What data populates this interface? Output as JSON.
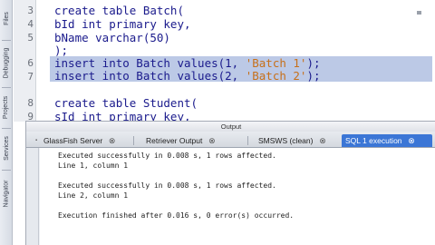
{
  "sidebar": {
    "tabs": [
      {
        "id": "files",
        "label": "Files"
      },
      {
        "id": "debugging",
        "label": "Debugging"
      },
      {
        "id": "projects",
        "label": "Projects"
      },
      {
        "id": "services",
        "label": "Services"
      },
      {
        "id": "navigator",
        "label": "Navigator"
      }
    ]
  },
  "editor": {
    "line_numbers": [
      "3",
      "4",
      "5",
      "6",
      "7",
      "8",
      "9"
    ],
    "lines": [
      {
        "text": "create table Batch("
      },
      {
        "text": "bId int primary key,"
      },
      {
        "text": "bName varchar(50)"
      },
      {
        "text": ");"
      },
      {
        "pre": "insert into Batch values(1, ",
        "str": "'Batch 1'",
        "post": ");"
      },
      {
        "pre": "insert into Batch values(2, ",
        "str": "'Batch 2'",
        "post": ");"
      },
      {
        "text": ""
      },
      {
        "text": "create table Student("
      },
      {
        "text": "sId int primary key,"
      }
    ]
  },
  "output": {
    "title": "Output",
    "tabs": [
      {
        "label": "GlassFish Server",
        "active": false
      },
      {
        "label": "Retriever Output",
        "active": false
      },
      {
        "label": "SMSWS (clean)",
        "active": false
      },
      {
        "label": "SQL 1 execution",
        "active": true
      }
    ],
    "lines": [
      "Executed successfully in 0.008 s, 1 rows affected.",
      "Line 1, column 1",
      "",
      "Executed successfully in 0.008 s, 1 rows affected.",
      "Line 2, column 1",
      "",
      "Execution finished after 0.016 s, 0 error(s) occurred."
    ]
  },
  "colors": {
    "keyword": "#1a1a8c",
    "string": "#c7701a",
    "selection": "#bcc9e6",
    "active_tab": "#3b76d6"
  }
}
